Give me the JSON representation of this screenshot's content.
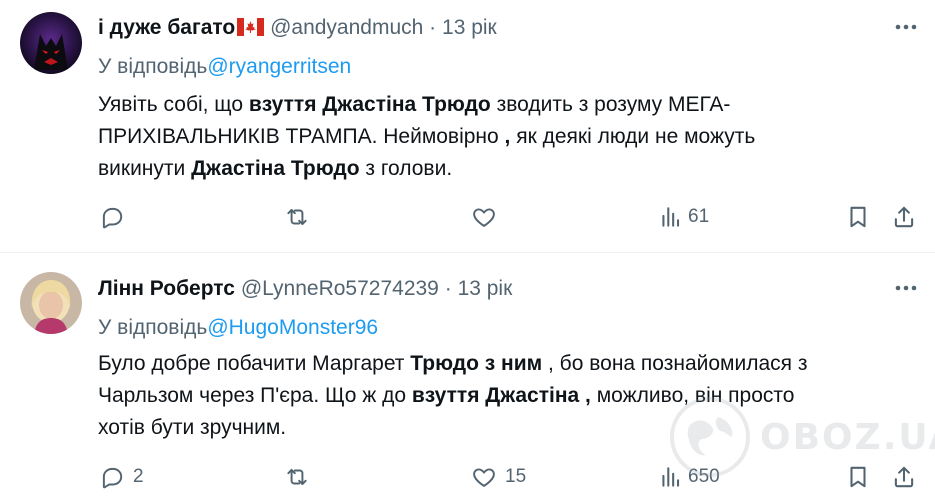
{
  "tweets": [
    {
      "author_name": "і дуже багато",
      "flag": "🇨🇦",
      "handle": "@andyandmuch",
      "separator": "·",
      "time": "13 рік",
      "reply_prefix": "У відповідь",
      "reply_to": "@ryangerritsen",
      "body": [
        {
          "t": "Уявіть собі, що ",
          "b": false
        },
        {
          "t": "взуття Джастіна Трюдо",
          "b": true
        },
        {
          "t": " зводить з розуму МЕГА-",
          "b": false
        },
        {
          "t": "ПРИХІВАЛЬНИКІВ ТРАМПА. Неймовірно ",
          "b": false
        },
        {
          "t": ",",
          "b": true
        },
        {
          "t": " як деякі люди не можуть",
          "b": false
        },
        {
          "t": "викинути ",
          "b": false
        },
        {
          "t": "Джастіна Трюдо",
          "b": true
        },
        {
          "t": " з голови.",
          "b": false
        }
      ],
      "actions": {
        "replies": "",
        "retweets": "",
        "likes": "",
        "views": "61"
      }
    },
    {
      "author_name": "Лінн Робертс",
      "handle": "@LynneRo57274239",
      "separator": "·",
      "time": "13 рік",
      "reply_prefix": "У відповідь",
      "reply_to": "@HugoMonster96",
      "body": [
        {
          "t": "Було добре побачити Маргарет ",
          "b": false
        },
        {
          "t": "Трюдо з ним",
          "b": true
        },
        {
          "t": " , бо вона познайомилася з",
          "b": false
        },
        {
          "t": "Чарльзом через П'єра. Що ж до ",
          "b": false
        },
        {
          "t": "взуття Джастіна ,",
          "b": true
        },
        {
          "t": " можливо, він просто",
          "b": false
        },
        {
          "t": "хотів бути зручним.",
          "b": false
        }
      ],
      "actions": {
        "replies": "2",
        "retweets": "",
        "likes": "15",
        "views": "650"
      }
    }
  ],
  "icons": {
    "more": "more-horizontal-icon",
    "reply": "reply-bubble-icon",
    "retweet": "retweet-icon",
    "like": "heart-icon",
    "views": "views-bar-chart-icon",
    "bookmark": "bookmark-icon",
    "share": "share-upload-icon"
  },
  "watermark": {
    "text": "OBOZ.UA"
  },
  "colors": {
    "link": "#1d9bf0",
    "secondary": "#536471",
    "text": "#0f1419",
    "divider": "#eff3f4"
  }
}
